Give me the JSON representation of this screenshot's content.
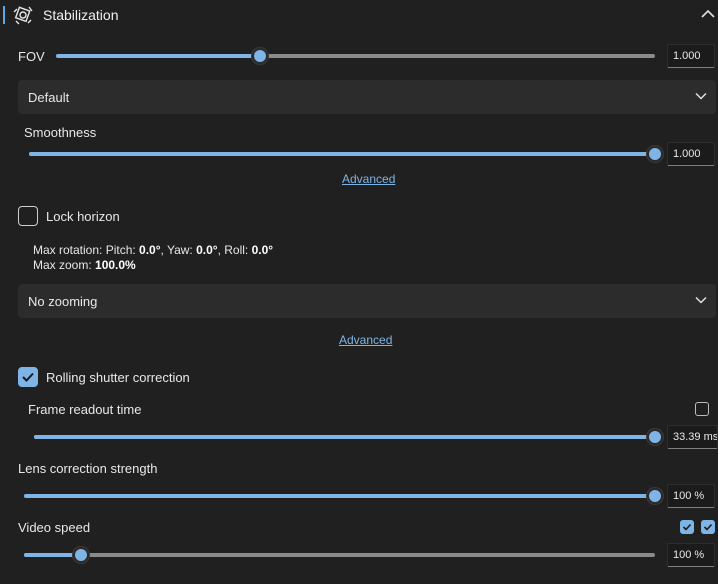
{
  "header": {
    "title": "Stabilization",
    "icon": "stabilization-icon"
  },
  "fov": {
    "label": "FOV",
    "value_text": "1.000",
    "fraction": 0.34
  },
  "smoothing_method": {
    "selected": "Default"
  },
  "smoothness": {
    "label": "Smoothness",
    "value_text": "1.000",
    "fraction": 1.0,
    "advanced_link": "Advanced"
  },
  "lock_horizon": {
    "label": "Lock horizon",
    "checked": false
  },
  "max_info": {
    "rotation_prefix": "Max rotation: Pitch: ",
    "pitch": "0.0°",
    "yaw_prefix": ", Yaw: ",
    "yaw": "0.0°",
    "roll_prefix": ", Roll: ",
    "roll": "0.0°",
    "zoom_prefix": "Max zoom: ",
    "zoom": "100.0%"
  },
  "zooming": {
    "selected": "No zooming",
    "advanced_link": "Advanced"
  },
  "rolling_shutter": {
    "label": "Rolling shutter correction",
    "checked": true
  },
  "frame_readout": {
    "label": "Frame readout time",
    "value_text": "33.39 ms",
    "fraction": 1.0,
    "checkbox_checked": false
  },
  "lens_correction": {
    "label": "Lens correction strength",
    "value_text": "100 %",
    "fraction": 1.0
  },
  "video_speed": {
    "label": "Video speed",
    "value_text": "100 %",
    "fraction": 0.09,
    "checkbox1_checked": true,
    "checkbox2_checked": true
  },
  "colors": {
    "accent": "#7fb4e6",
    "background": "#202020",
    "track": "#8a8a8a"
  }
}
